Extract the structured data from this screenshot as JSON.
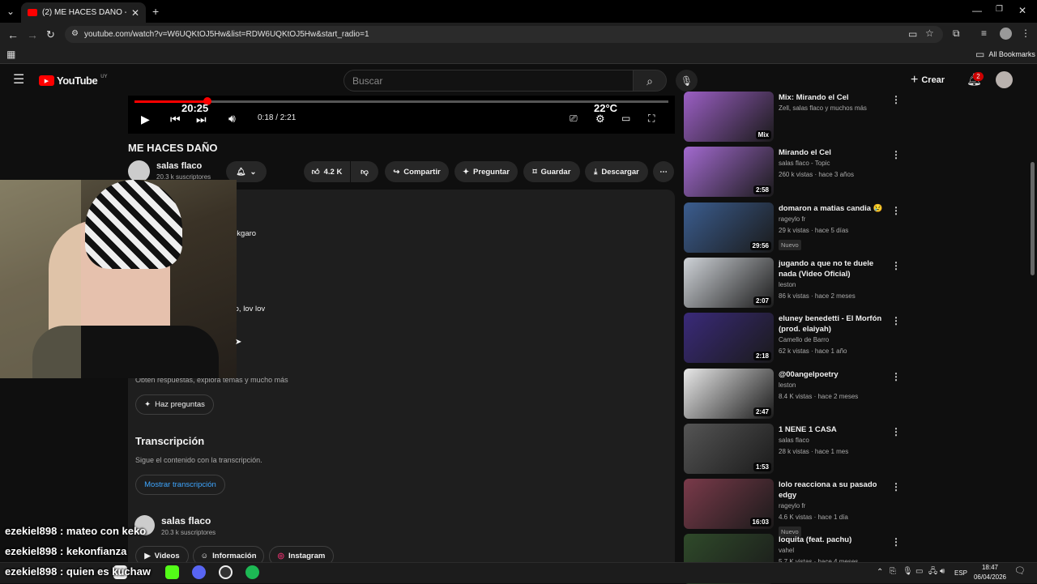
{
  "browser": {
    "tab_title": "(2) ME HACES DAÑO - YouTube",
    "url": "youtube.com/watch?v=W6UQKtOJ5Hw&list=RDW6UQKtOJ5Hw&start_radio=1",
    "bookmarks_label": "All Bookmarks"
  },
  "youtube_header": {
    "logo": "YouTube",
    "region": "UY",
    "search_placeholder": "Buscar",
    "create_label": "Crear",
    "notification_count": "2"
  },
  "player": {
    "time": "0:18 / 2:21",
    "progress": 0.13,
    "overlay_clock": "20:25",
    "overlay_temp": "22°C"
  },
  "video": {
    "title": "ME HACES DAÑO",
    "channel": "salas flaco",
    "subscribers": "20.3 k suscriptores",
    "likes": "4.2 K",
    "share": "Compartir",
    "ask": "Preguntar",
    "save": "Guardar",
    "download": "Descargar"
  },
  "description": {
    "partial_1": "o",
    "partial_2": "okgaro",
    "partial_3": "to, lov lov",
    "ask_subtitle": "Obtén respuestas, explora temas y mucho más",
    "ask_button": "Haz preguntas",
    "transcript_heading": "Transcripción",
    "transcript_subtitle": "Sigue el contenido con la transcripción.",
    "transcript_button": "Mostrar transcripción",
    "channel_name": "salas flaco",
    "channel_subs": "20.3 k suscriptores",
    "tab_videos": "Videos",
    "tab_info": "Información",
    "tab_instagram": "Instagram"
  },
  "chat": [
    {
      "user": "ezekiel898",
      "message": "mateo con keko"
    },
    {
      "user": "ezekiel898",
      "message": "kekonfianza"
    },
    {
      "user": "ezekiel898",
      "message": "quien es kuchaw"
    }
  ],
  "recommendations": [
    {
      "title": "Mix: Mirando el Cel",
      "channel": "Zell, salas flaco y muchos más",
      "meta": "",
      "duration": "Mix",
      "badge": "",
      "color": "#9b5fc4"
    },
    {
      "title": "Mirando el Cel",
      "channel": "salas flaco - Topic",
      "meta": "260 k vistas · hace 3 años",
      "duration": "2:58",
      "badge": "",
      "color": "#a36ad0"
    },
    {
      "title": "domaron a matias candia 😢",
      "channel": "rageylo fr",
      "meta": "29 k vistas · hace 5 días",
      "duration": "29:56",
      "badge": "Nuevo",
      "color": "#3b5d8f"
    },
    {
      "title": "jugando a que no te duele nada (Video Oficial)",
      "channel": "leston",
      "meta": "86 k vistas · hace 2 meses",
      "duration": "2:07",
      "badge": "",
      "color": "#cfd3d8"
    },
    {
      "title": "eluney benedetti - El Morfón (prod. elaiyah)",
      "channel": "Camello de Barro",
      "meta": "62 k vistas · hace 1 año",
      "duration": "2:18",
      "badge": "",
      "color": "#3a2a7a"
    },
    {
      "title": "@00angelpoetry",
      "channel": "leston",
      "meta": "8.4 K vistas · hace 2 meses",
      "duration": "2:47",
      "badge": "",
      "color": "#e8e8e8"
    },
    {
      "title": "1 NENE 1 CASA",
      "channel": "salas flaco",
      "meta": "28 k vistas · hace 1 mes",
      "duration": "1:53",
      "badge": "",
      "color": "#555"
    },
    {
      "title": "lolo reacciona a su pasado edgy",
      "channel": "rageylo fr",
      "meta": "4.6 K vistas · hace 1 día",
      "duration": "16:03",
      "badge": "Nuevo",
      "color": "#7a3a4a"
    },
    {
      "title": "loquita (feat. pachu)",
      "channel": "vahel",
      "meta": "5.7 K vistas · hace 4 meses",
      "duration": "",
      "badge": "",
      "color": "#2f4a2a"
    }
  ],
  "taskbar": {
    "lang": "ESP",
    "time": "18:47",
    "date": "06/04/2026"
  }
}
